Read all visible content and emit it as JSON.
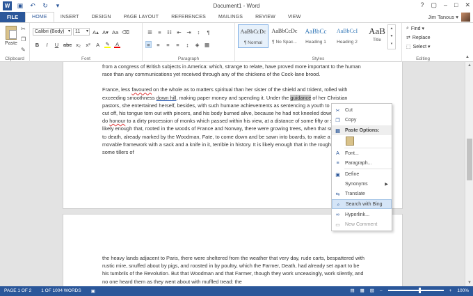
{
  "window": {
    "title": "Document1 - Word",
    "controls": [
      "?",
      "▢",
      "–",
      "□",
      "✕"
    ]
  },
  "tabs": {
    "file": "FILE",
    "items": [
      "HOME",
      "INSERT",
      "DESIGN",
      "PAGE LAYOUT",
      "REFERENCES",
      "MAILINGS",
      "REVIEW",
      "VIEW"
    ],
    "active": "HOME"
  },
  "user": {
    "name": "Jim Tanous ▾"
  },
  "ribbon": {
    "clipboard": {
      "paste": "Paste",
      "label": "Clipboard"
    },
    "font": {
      "name": "Calibri (Body)",
      "size": "11",
      "label": "Font",
      "bold": "B",
      "italic": "I",
      "underline": "U",
      "strike": "abc",
      "sub": "x₂",
      "sup": "x²",
      "grow": "A▴",
      "shrink": "A▾",
      "case": "Aa",
      "clear": "⌫"
    },
    "paragraph": {
      "label": "Paragraph",
      "pilcrow": "¶"
    },
    "styles": {
      "label": "Styles",
      "items": [
        {
          "preview": "AaBbCcDc",
          "name": "¶ Normal"
        },
        {
          "preview": "AaBbCcDc",
          "name": "¶ No Spac..."
        },
        {
          "preview": "AaBbCc",
          "name": "Heading 1"
        },
        {
          "preview": "AaBbCcI",
          "name": "Heading 2"
        },
        {
          "preview": "AaB",
          "name": "Title"
        }
      ]
    },
    "editing": {
      "label": "Editing",
      "find": "Find ▾",
      "replace": "Replace",
      "select": "Select ▾"
    }
  },
  "document": {
    "p1": "from a congress of British subjects in America: which, strange to relate, have proved more important to the human race than any communications yet received through any of the chickens of the Cock-lane brood.",
    "p2_a": "France, less ",
    "p2_b": "favoured",
    "p2_c": " on the whole as to matters spiritual than her sister of the shield and trident, rolled with exceeding smoothness ",
    "p2_d": "down hill",
    "p2_e": ", making paper money and spending it. Under the ",
    "p2_f": "guidance",
    "p2_g": " of her Christian pastors, she entertained herself, besides, with such humane achievements as sentencing a youth to have his hands cut off, his tongue torn out with pincers, and his body burned alive, because he had not kneeled down in the rain to do ",
    "p2_h": "honour",
    "p2_i": " to a dirty procession of monks which passed within his view, at a distance of some fifty or sixty yards. It is likely enough that, rooted in the woods of France and Norway, there were growing trees, when that sufferer was put to death, already marked by the Woodman, Fate, to come down and be sawn into boards, to make a certain movable framework with a sack and a knife in it, terrible in history. It is likely enough that in the rough outhouses of some tillers of",
    "p3": "the heavy lands adjacent to Paris, there were sheltered from the weather that very day, rude carts, bespattered with rustic mire, snuffed about by pigs, and roosted in by poultry, which the Farmer, Death, had already set apart to be his tumbrils of the Revolution. But that Woodman and that Farmer, though they work unceasingly, work silently, and no one heard them as they went about with muffled tread: the"
  },
  "context_menu": {
    "cut": "Cut",
    "copy": "Copy",
    "paste_options": "Paste Options:",
    "font": "Font...",
    "paragraph": "Paragraph...",
    "define": "Define",
    "synonyms": "Synonyms",
    "translate": "Translate",
    "search_bing": "Search with Bing",
    "hyperlink": "Hyperlink...",
    "new_comment": "New Comment"
  },
  "status": {
    "page": "PAGE 1 OF 2",
    "words": "1 OF 1004 WORDS",
    "zoom": "100%",
    "zoom_minus": "–",
    "zoom_plus": "+"
  },
  "colors": {
    "accent": "#2b579a",
    "hover": "#d5e5f7"
  }
}
